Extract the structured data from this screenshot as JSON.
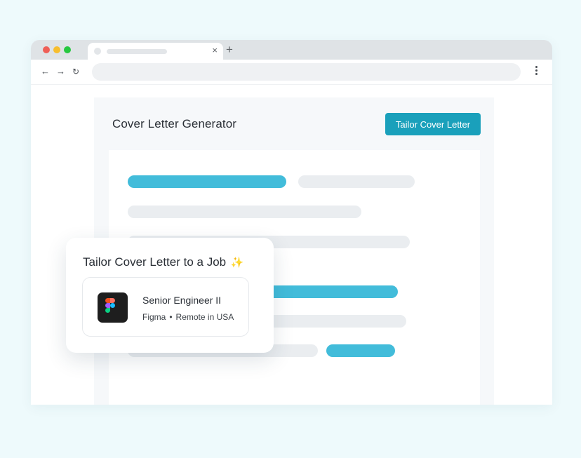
{
  "browser": {
    "tab_close_glyph": "×",
    "new_tab_glyph": "+",
    "icons": {
      "back": "arrow-left-icon",
      "forward": "arrow-right-icon",
      "reload": "reload-icon",
      "menu": "kebab-menu-icon"
    },
    "glyphs": {
      "back": "←",
      "forward": "→",
      "reload": "↻"
    }
  },
  "app": {
    "title": "Cover Letter Generator",
    "primary_action": "Tailor Cover Letter",
    "accent_color": "#1aa0bb"
  },
  "job_card": {
    "title": "Tailor Cover Letter to a Job",
    "sparkle": "✨",
    "job": {
      "title": "Senior Engineer II",
      "company": "Figma",
      "separator": "•",
      "location": "Remote in USA",
      "logo": "figma-logo-icon"
    }
  }
}
